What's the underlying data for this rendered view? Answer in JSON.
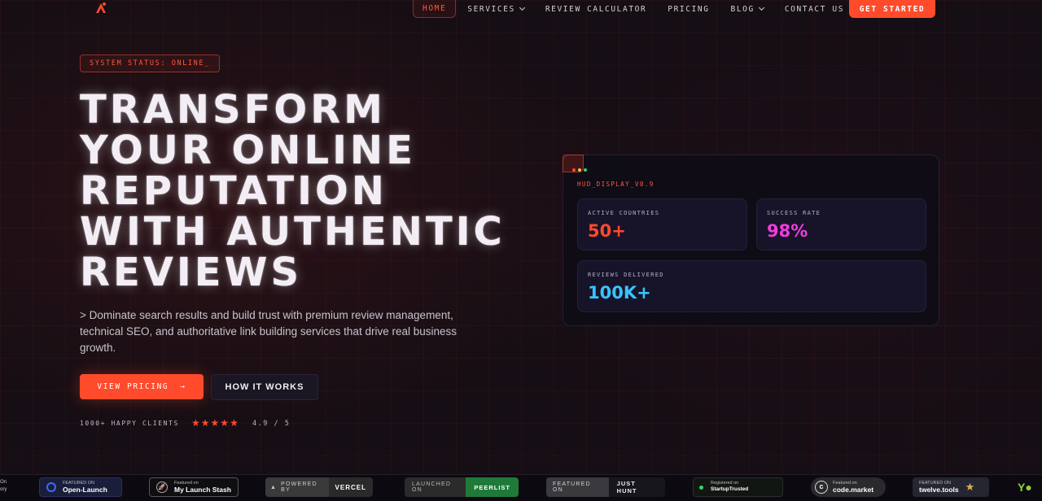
{
  "nav": {
    "items": [
      {
        "label": "HOME",
        "dropdown": false,
        "active": true
      },
      {
        "label": "SERVICES",
        "dropdown": true
      },
      {
        "label": "REVIEW CALCULATOR",
        "dropdown": false
      },
      {
        "label": "PRICING",
        "dropdown": false
      },
      {
        "label": "BLOG",
        "dropdown": true
      },
      {
        "label": "CONTACT US",
        "dropdown": false
      }
    ],
    "cta": "GET STARTED"
  },
  "hero": {
    "status": "SYSTEM STATUS: ONLINE_",
    "headline": [
      "TRANSFORM",
      "YOUR ONLINE",
      "REPUTATION",
      "WITH AUTHENTIC",
      "REVIEWS"
    ],
    "subtext": "> Dominate search results and build trust with premium review management, technical SEO, and authoritative link building services that drive real business growth.",
    "primary_button": "VIEW PRICING",
    "primary_arrow": "→",
    "secondary_button": "HOW IT WORKS",
    "clients": "1000+ HAPPY CLIENTS",
    "rating": "4.9 / 5",
    "star_count": 5
  },
  "hud": {
    "label": "HUD_DISPLAY_V0.9",
    "stats": [
      {
        "label": "ACTIVE COUNTRIES",
        "value": "50+",
        "color": "#ff4b2b"
      },
      {
        "label": "SUCCESS RATE",
        "value": "98%",
        "color": "#ee3ddc"
      },
      {
        "label": "REVIEWS DELIVERED",
        "value": "100K+",
        "color": "#39c4ff"
      }
    ]
  },
  "badges": {
    "partial_left": [
      "On",
      "ory"
    ],
    "open_launch": {
      "small": "FEATURED ON",
      "big": "Open-Launch"
    },
    "launch_stash": {
      "small": "Featured on",
      "big": "My Launch Stash"
    },
    "vercel": {
      "left": "POWERED BY",
      "right": "VERCEL"
    },
    "peerlist": {
      "left": "LAUNCHED ON",
      "right": "PEERLIST"
    },
    "justhunt": {
      "left": "FEATURED ON",
      "right": "JUST HUNT"
    },
    "startup": {
      "small": "Registered on",
      "big": "StartupTrusted"
    },
    "codemarket": {
      "small": "Featured on",
      "big": "code.market"
    },
    "twelve": {
      "small": "FEATURED ON",
      "big": "twelve.tools"
    }
  }
}
